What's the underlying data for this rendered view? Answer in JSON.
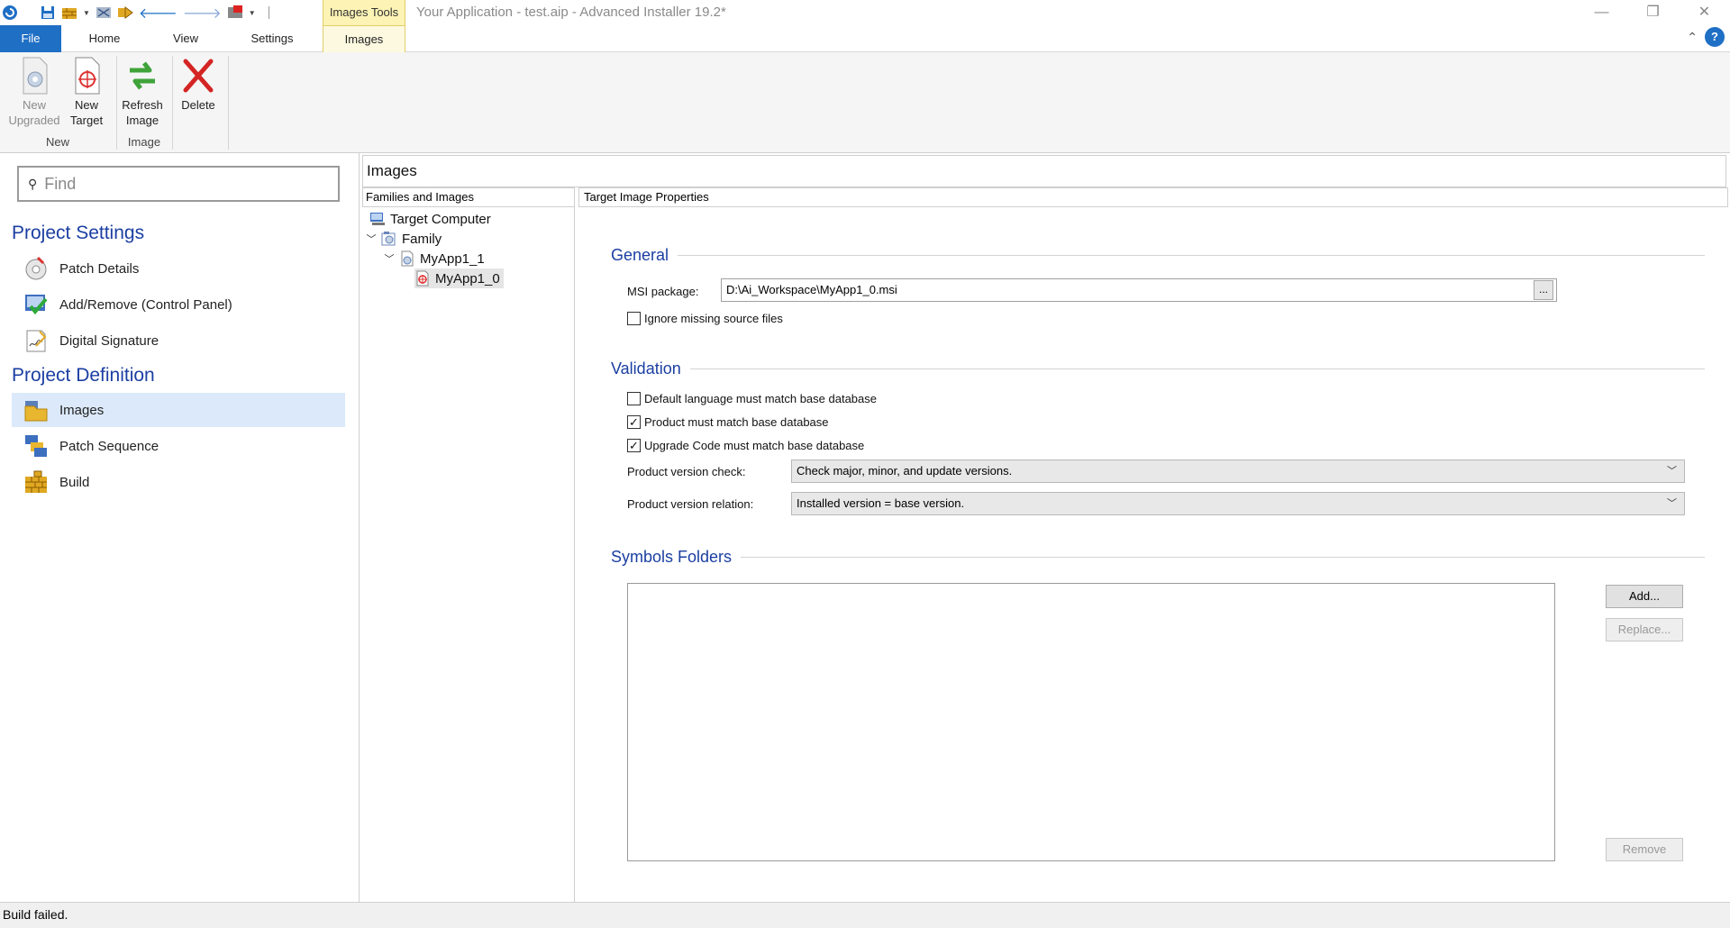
{
  "titlebar": {
    "context_tab": "Images Tools",
    "window_title": "Your Application - test.aip - Advanced Installer 19.2*",
    "minimize": "—",
    "restore": "❐",
    "close": "✕"
  },
  "tabs": {
    "file": "File",
    "home": "Home",
    "view": "View",
    "settings": "Settings",
    "images": "Images",
    "collapse": "⌃",
    "help": "?"
  },
  "ribbon": {
    "new_upgraded_1": "New",
    "new_upgraded_2": "Upgraded",
    "new_target_1": "New",
    "new_target_2": "Target",
    "refresh_1": "Refresh",
    "refresh_2": "Image",
    "delete": "Delete",
    "group_new": "New",
    "group_image": "Image"
  },
  "nav": {
    "find_placeholder": "Find",
    "project_settings": "Project Settings",
    "project_definition": "Project Definition",
    "items": [
      {
        "label": "Patch Details"
      },
      {
        "label": "Add/Remove (Control Panel)"
      },
      {
        "label": "Digital Signature"
      },
      {
        "label": "Images"
      },
      {
        "label": "Patch Sequence"
      },
      {
        "label": "Build"
      }
    ]
  },
  "main": {
    "header": "Images",
    "families_header": "Families and Images",
    "properties_header": "Target Image Properties",
    "tree": {
      "target_computer": "Target Computer",
      "family": "Family",
      "myapp1_1": "MyApp1_1",
      "myapp1_0": "MyApp1_0"
    },
    "general": {
      "title": "General",
      "msi_label": "MSI package:",
      "msi_value": "D:\\Ai_Workspace\\MyApp1_0.msi",
      "browse": "...",
      "ignore_missing": "Ignore missing source files",
      "ignore_missing_checked": false
    },
    "validation": {
      "title": "Validation",
      "default_language": "Default language must match base database",
      "default_language_checked": false,
      "product_match": "Product must match base database",
      "product_match_checked": true,
      "upgrade_code": "Upgrade Code must match base database",
      "upgrade_code_checked": true,
      "version_check_label": "Product version check:",
      "version_check_value": "Check major, minor, and update versions.",
      "version_relation_label": "Product version relation:",
      "version_relation_value": "Installed version = base version."
    },
    "symbols": {
      "title": "Symbols Folders",
      "add": "Add...",
      "replace": "Replace...",
      "remove": "Remove"
    }
  },
  "status": {
    "text": "Build failed."
  },
  "colors": {
    "accent": "#1f6fc5",
    "section_title": "#1b3fa2",
    "context_tab": "#fdf3b5",
    "selected_nav": "#dbe9fa"
  }
}
